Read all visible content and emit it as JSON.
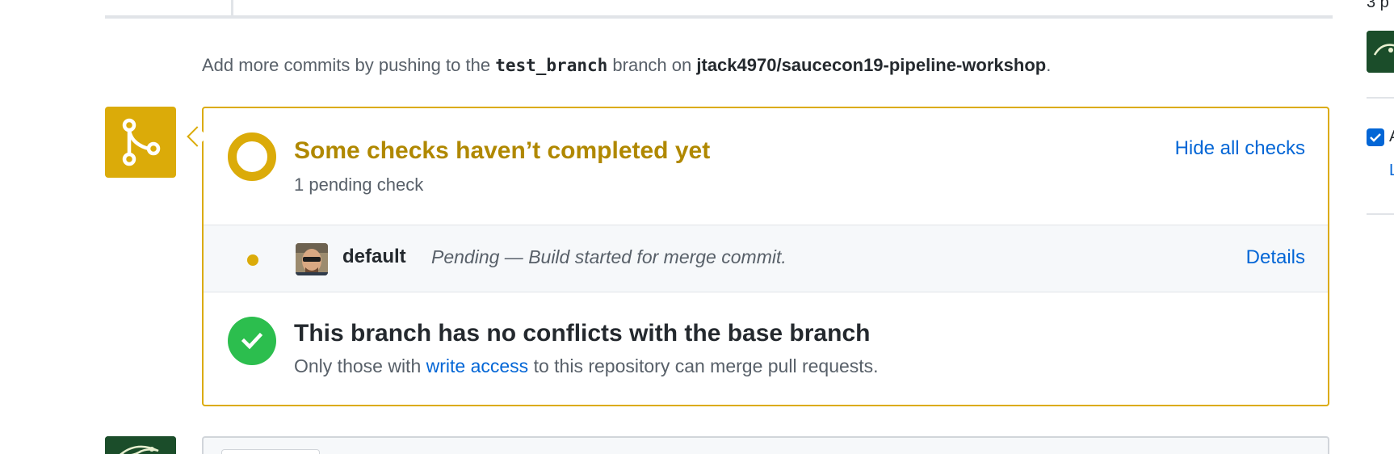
{
  "push_hint": {
    "prefix": "Add more commits by pushing to the",
    "branch": "test_branch",
    "middle": "branch on",
    "repo": "jtack4970/saucecon19-pipeline-workshop",
    "suffix": "."
  },
  "merge_status": {
    "title": "Some checks haven’t completed yet",
    "subtitle": "1 pending check",
    "hide_checks_label": "Hide all checks",
    "badge_icon": "git-merge-icon",
    "status_icon": "pending-ring-icon",
    "accent_color": "#dbab09",
    "title_color": "#b08800"
  },
  "checks": [
    {
      "name": "default",
      "description": "Pending — Build started for merge commit.",
      "details_label": "Details",
      "status_icon": "pending-dot-icon"
    }
  ],
  "conflicts": {
    "title": "This branch has no conflicts with the base branch",
    "sub_prefix": "Only those with",
    "sub_link": "write access",
    "sub_suffix": "to this repository can merge pull requests.",
    "icon": "check-circle-icon",
    "success_color": "#2cbe4e"
  },
  "sidebar": {
    "partial_top_text": "3 p",
    "partial_checkbox_text": "A",
    "partial_link_text": "L"
  },
  "link_color": "#0366d6"
}
